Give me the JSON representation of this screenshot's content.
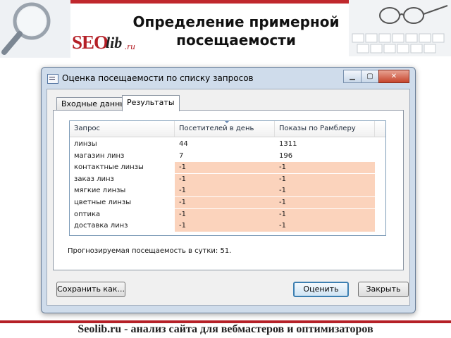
{
  "slide": {
    "title_line1": "Определение примерной",
    "title_line2": "посещаемости",
    "logo": {
      "seo": "SEO",
      "lib": "lib",
      "ru": ".ru"
    },
    "footer": "Seolib.ru - анализ сайта для вебмастеров и оптимизаторов"
  },
  "window": {
    "title": "Оценка посещаемости по списку запросов",
    "controls": {
      "minimize": "▁",
      "maximize": "▢",
      "close": "✕"
    },
    "tabs": [
      {
        "label": "Входные данные",
        "active": false
      },
      {
        "label": "Результаты",
        "active": true
      }
    ],
    "table": {
      "columns": [
        "Запрос",
        "Посетителей в день",
        "Показы по Рамблеру"
      ],
      "rows": [
        {
          "query": "линзы",
          "visitors": "44",
          "impressions": "1311",
          "highlight": false
        },
        {
          "query": "магазин линз",
          "visitors": "7",
          "impressions": "196",
          "highlight": false
        },
        {
          "query": "контактные линзы",
          "visitors": "-1",
          "impressions": "-1",
          "highlight": true
        },
        {
          "query": "заказ линз",
          "visitors": "-1",
          "impressions": "-1",
          "highlight": true
        },
        {
          "query": "мягкие линзы",
          "visitors": "-1",
          "impressions": "-1",
          "highlight": true
        },
        {
          "query": "цветные линзы",
          "visitors": "-1",
          "impressions": "-1",
          "highlight": true
        },
        {
          "query": "оптика",
          "visitors": "-1",
          "impressions": "-1",
          "highlight": true
        },
        {
          "query": "доставка линз",
          "visitors": "-1",
          "impressions": "-1",
          "highlight": true
        }
      ],
      "highlight_color": "#fbd3bc"
    },
    "forecast": "Прогнозируемая посещаемость в сутки: 51.",
    "buttons": {
      "save": "Сохранить как...",
      "evaluate": "Оценить",
      "close": "Закрыть"
    }
  },
  "colors": {
    "accent": "#b52027",
    "window_frame": "#cfdceb"
  }
}
